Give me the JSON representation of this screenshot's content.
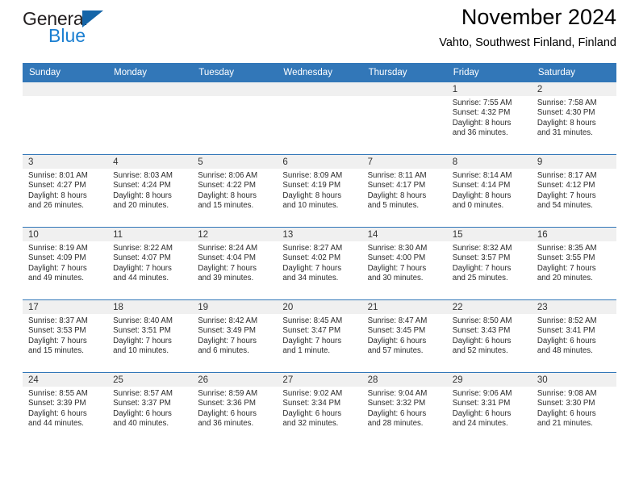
{
  "brand": {
    "name_top": "General",
    "name_bottom": "Blue",
    "triangle_color": "#1565a8",
    "blue_color": "#1b7fd1"
  },
  "header": {
    "title": "November 2024",
    "subtitle": "Vahto, Southwest Finland, Finland"
  },
  "calendar": {
    "header_bg": "#3277b8",
    "date_band_bg": "#f0f0f0",
    "weekdays": [
      "Sunday",
      "Monday",
      "Tuesday",
      "Wednesday",
      "Thursday",
      "Friday",
      "Saturday"
    ],
    "weeks": [
      [
        {
          "date": "",
          "empty": true,
          "lines": []
        },
        {
          "date": "",
          "empty": true,
          "lines": []
        },
        {
          "date": "",
          "empty": true,
          "lines": []
        },
        {
          "date": "",
          "empty": true,
          "lines": []
        },
        {
          "date": "",
          "empty": true,
          "lines": []
        },
        {
          "date": "1",
          "sunrise": "Sunrise: 7:55 AM",
          "sunset": "Sunset: 4:32 PM",
          "daylight1": "Daylight: 8 hours",
          "daylight2": "and 36 minutes."
        },
        {
          "date": "2",
          "sunrise": "Sunrise: 7:58 AM",
          "sunset": "Sunset: 4:30 PM",
          "daylight1": "Daylight: 8 hours",
          "daylight2": "and 31 minutes."
        }
      ],
      [
        {
          "date": "3",
          "sunrise": "Sunrise: 8:01 AM",
          "sunset": "Sunset: 4:27 PM",
          "daylight1": "Daylight: 8 hours",
          "daylight2": "and 26 minutes."
        },
        {
          "date": "4",
          "sunrise": "Sunrise: 8:03 AM",
          "sunset": "Sunset: 4:24 PM",
          "daylight1": "Daylight: 8 hours",
          "daylight2": "and 20 minutes."
        },
        {
          "date": "5",
          "sunrise": "Sunrise: 8:06 AM",
          "sunset": "Sunset: 4:22 PM",
          "daylight1": "Daylight: 8 hours",
          "daylight2": "and 15 minutes."
        },
        {
          "date": "6",
          "sunrise": "Sunrise: 8:09 AM",
          "sunset": "Sunset: 4:19 PM",
          "daylight1": "Daylight: 8 hours",
          "daylight2": "and 10 minutes."
        },
        {
          "date": "7",
          "sunrise": "Sunrise: 8:11 AM",
          "sunset": "Sunset: 4:17 PM",
          "daylight1": "Daylight: 8 hours",
          "daylight2": "and 5 minutes."
        },
        {
          "date": "8",
          "sunrise": "Sunrise: 8:14 AM",
          "sunset": "Sunset: 4:14 PM",
          "daylight1": "Daylight: 8 hours",
          "daylight2": "and 0 minutes."
        },
        {
          "date": "9",
          "sunrise": "Sunrise: 8:17 AM",
          "sunset": "Sunset: 4:12 PM",
          "daylight1": "Daylight: 7 hours",
          "daylight2": "and 54 minutes."
        }
      ],
      [
        {
          "date": "10",
          "sunrise": "Sunrise: 8:19 AM",
          "sunset": "Sunset: 4:09 PM",
          "daylight1": "Daylight: 7 hours",
          "daylight2": "and 49 minutes."
        },
        {
          "date": "11",
          "sunrise": "Sunrise: 8:22 AM",
          "sunset": "Sunset: 4:07 PM",
          "daylight1": "Daylight: 7 hours",
          "daylight2": "and 44 minutes."
        },
        {
          "date": "12",
          "sunrise": "Sunrise: 8:24 AM",
          "sunset": "Sunset: 4:04 PM",
          "daylight1": "Daylight: 7 hours",
          "daylight2": "and 39 minutes."
        },
        {
          "date": "13",
          "sunrise": "Sunrise: 8:27 AM",
          "sunset": "Sunset: 4:02 PM",
          "daylight1": "Daylight: 7 hours",
          "daylight2": "and 34 minutes."
        },
        {
          "date": "14",
          "sunrise": "Sunrise: 8:30 AM",
          "sunset": "Sunset: 4:00 PM",
          "daylight1": "Daylight: 7 hours",
          "daylight2": "and 30 minutes."
        },
        {
          "date": "15",
          "sunrise": "Sunrise: 8:32 AM",
          "sunset": "Sunset: 3:57 PM",
          "daylight1": "Daylight: 7 hours",
          "daylight2": "and 25 minutes."
        },
        {
          "date": "16",
          "sunrise": "Sunrise: 8:35 AM",
          "sunset": "Sunset: 3:55 PM",
          "daylight1": "Daylight: 7 hours",
          "daylight2": "and 20 minutes."
        }
      ],
      [
        {
          "date": "17",
          "sunrise": "Sunrise: 8:37 AM",
          "sunset": "Sunset: 3:53 PM",
          "daylight1": "Daylight: 7 hours",
          "daylight2": "and 15 minutes."
        },
        {
          "date": "18",
          "sunrise": "Sunrise: 8:40 AM",
          "sunset": "Sunset: 3:51 PM",
          "daylight1": "Daylight: 7 hours",
          "daylight2": "and 10 minutes."
        },
        {
          "date": "19",
          "sunrise": "Sunrise: 8:42 AM",
          "sunset": "Sunset: 3:49 PM",
          "daylight1": "Daylight: 7 hours",
          "daylight2": "and 6 minutes."
        },
        {
          "date": "20",
          "sunrise": "Sunrise: 8:45 AM",
          "sunset": "Sunset: 3:47 PM",
          "daylight1": "Daylight: 7 hours",
          "daylight2": "and 1 minute."
        },
        {
          "date": "21",
          "sunrise": "Sunrise: 8:47 AM",
          "sunset": "Sunset: 3:45 PM",
          "daylight1": "Daylight: 6 hours",
          "daylight2": "and 57 minutes."
        },
        {
          "date": "22",
          "sunrise": "Sunrise: 8:50 AM",
          "sunset": "Sunset: 3:43 PM",
          "daylight1": "Daylight: 6 hours",
          "daylight2": "and 52 minutes."
        },
        {
          "date": "23",
          "sunrise": "Sunrise: 8:52 AM",
          "sunset": "Sunset: 3:41 PM",
          "daylight1": "Daylight: 6 hours",
          "daylight2": "and 48 minutes."
        }
      ],
      [
        {
          "date": "24",
          "sunrise": "Sunrise: 8:55 AM",
          "sunset": "Sunset: 3:39 PM",
          "daylight1": "Daylight: 6 hours",
          "daylight2": "and 44 minutes."
        },
        {
          "date": "25",
          "sunrise": "Sunrise: 8:57 AM",
          "sunset": "Sunset: 3:37 PM",
          "daylight1": "Daylight: 6 hours",
          "daylight2": "and 40 minutes."
        },
        {
          "date": "26",
          "sunrise": "Sunrise: 8:59 AM",
          "sunset": "Sunset: 3:36 PM",
          "daylight1": "Daylight: 6 hours",
          "daylight2": "and 36 minutes."
        },
        {
          "date": "27",
          "sunrise": "Sunrise: 9:02 AM",
          "sunset": "Sunset: 3:34 PM",
          "daylight1": "Daylight: 6 hours",
          "daylight2": "and 32 minutes."
        },
        {
          "date": "28",
          "sunrise": "Sunrise: 9:04 AM",
          "sunset": "Sunset: 3:32 PM",
          "daylight1": "Daylight: 6 hours",
          "daylight2": "and 28 minutes."
        },
        {
          "date": "29",
          "sunrise": "Sunrise: 9:06 AM",
          "sunset": "Sunset: 3:31 PM",
          "daylight1": "Daylight: 6 hours",
          "daylight2": "and 24 minutes."
        },
        {
          "date": "30",
          "sunrise": "Sunrise: 9:08 AM",
          "sunset": "Sunset: 3:30 PM",
          "daylight1": "Daylight: 6 hours",
          "daylight2": "and 21 minutes."
        }
      ]
    ]
  }
}
